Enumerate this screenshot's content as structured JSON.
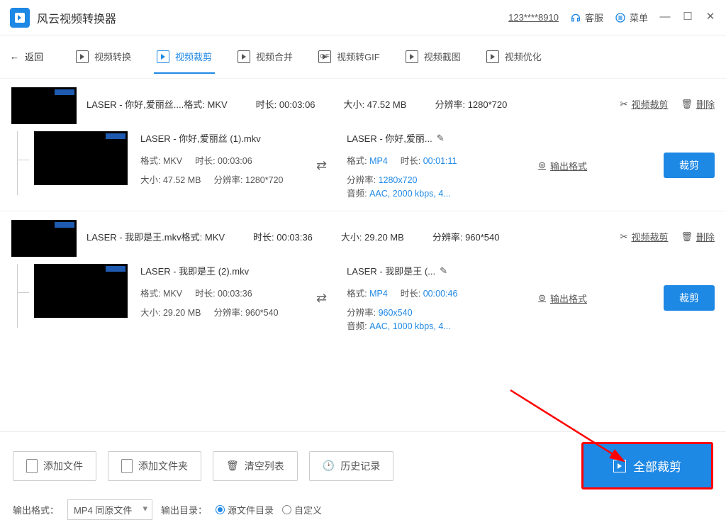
{
  "app": {
    "title": "风云视频转换器"
  },
  "titlebar": {
    "user_id": "123****8910",
    "support": "客服",
    "menu": "菜单"
  },
  "nav": {
    "back": "返回",
    "tabs": [
      {
        "label": "视频转换"
      },
      {
        "label": "视频裁剪"
      },
      {
        "label": "视频合并"
      },
      {
        "label": "视频转GIF"
      },
      {
        "label": "视频截图"
      },
      {
        "label": "视频优化"
      }
    ]
  },
  "items": [
    {
      "title": "LASER - 你好,爱丽丝....",
      "format_label": "格式:",
      "format": "MKV",
      "dur_label": "时长:",
      "duration": "00:03:06",
      "size_label": "大小:",
      "size": "47.52 MB",
      "res_label": "分辨率:",
      "resolution": "1280*720",
      "cut": "视频裁剪",
      "del": "删除",
      "sub": {
        "src": {
          "name": "LASER - 你好,爱丽丝 (1).mkv",
          "format_label": "格式:",
          "format": "MKV",
          "dur_label": "时长:",
          "duration": "00:03:06",
          "size_label": "大小:",
          "size": "47.52 MB",
          "res_label": "分辨率:",
          "resolution": "1280*720"
        },
        "dst": {
          "name": "LASER - 你好,爱丽...",
          "format_label": "格式:",
          "format": "MP4",
          "dur_label": "时长:",
          "duration": "00:01:11",
          "res_label": "分辨率:",
          "resolution": "1280x720",
          "audio_label": "音频:",
          "audio": "AAC, 2000 kbps, 4..."
        },
        "out_format": "输出格式",
        "cut_btn": "裁剪"
      }
    },
    {
      "title": "LASER - 我即是王.mkv",
      "format_label": "格式:",
      "format": "MKV",
      "dur_label": "时长:",
      "duration": "00:03:36",
      "size_label": "大小:",
      "size": "29.20 MB",
      "res_label": "分辨率:",
      "resolution": "960*540",
      "cut": "视频裁剪",
      "del": "删除",
      "sub": {
        "src": {
          "name": "LASER - 我即是王 (2).mkv",
          "format_label": "格式:",
          "format": "MKV",
          "dur_label": "时长:",
          "duration": "00:03:36",
          "size_label": "大小:",
          "size": "29.20 MB",
          "res_label": "分辨率:",
          "resolution": "960*540"
        },
        "dst": {
          "name": "LASER - 我即是王 (...",
          "format_label": "格式:",
          "format": "MP4",
          "dur_label": "时长:",
          "duration": "00:00:46",
          "res_label": "分辨率:",
          "resolution": "960x540",
          "audio_label": "音频:",
          "audio": "AAC, 1000 kbps, 4..."
        },
        "out_format": "输出格式",
        "cut_btn": "裁剪"
      }
    }
  ],
  "bottom": {
    "add_file": "添加文件",
    "add_folder": "添加文件夹",
    "clear_list": "清空列表",
    "history": "历史记录",
    "cut_all": "全部裁剪",
    "out_fmt_label": "输出格式：",
    "out_fmt_value": "MP4 同原文件",
    "out_dir_label": "输出目录：",
    "radio_src": "源文件目录",
    "radio_custom": "自定义"
  }
}
